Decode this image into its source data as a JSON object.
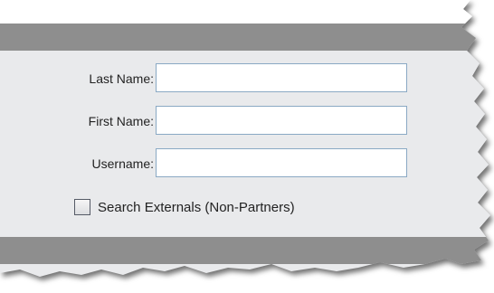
{
  "form": {
    "last_name_label": "Last Name:",
    "last_name_value": "",
    "first_name_label": "First Name:",
    "first_name_value": "",
    "username_label": "Username:",
    "username_value": "",
    "search_externals_label": "Search Externals (Non-Partners)",
    "search_externals_checked": false
  },
  "colors": {
    "bar": "#8e8e8e",
    "panel": "#e9eaec",
    "field_border": "#8aa9c4"
  }
}
